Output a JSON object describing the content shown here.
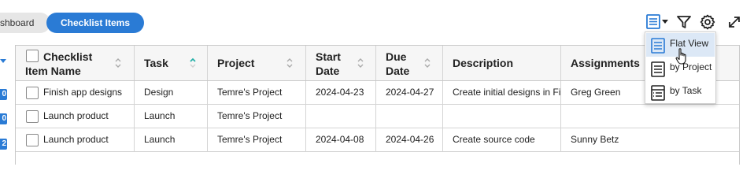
{
  "tabs": {
    "dashboard": "shboard",
    "active": "Checklist Items"
  },
  "toolbar": {
    "view_icon": "list-view-icon",
    "filter_icon": "filter-icon",
    "settings_icon": "gear-icon",
    "expand_icon": "expand-icon"
  },
  "gutter": {
    "badges": [
      "0",
      "0",
      "2"
    ]
  },
  "grid": {
    "headers": [
      {
        "line1": "Checklist",
        "line2": "Item Name"
      },
      {
        "line1": "Task"
      },
      {
        "line1": "Project"
      },
      {
        "line1": "Start",
        "line2": "Date"
      },
      {
        "line1": "Due",
        "line2": "Date"
      },
      {
        "line1": "Description"
      },
      {
        "line1": "Assignments"
      }
    ],
    "rows": [
      {
        "name": "Finish app designs",
        "task": "Design",
        "project": "Temre's Project",
        "start": "2024-04-23",
        "due": "2024-04-27",
        "description": "Create initial designs in Figma",
        "assignments": "Greg Green"
      },
      {
        "name": "Launch product",
        "task": "Launch",
        "project": "Temre's Project",
        "start": "",
        "due": "",
        "description": "",
        "assignments": ""
      },
      {
        "name": "Launch product",
        "task": "Launch",
        "project": "Temre's Project",
        "start": "2024-04-08",
        "due": "2024-04-26",
        "description": "Create source code",
        "assignments": "Sunny Betz"
      }
    ]
  },
  "view_menu": {
    "items": [
      {
        "label": "Flat View",
        "icon": "flat-view-icon",
        "selected": true
      },
      {
        "label": "by Project",
        "icon": "by-project-icon",
        "selected": false
      },
      {
        "label": "by Task",
        "icon": "by-task-icon",
        "selected": false
      }
    ]
  },
  "colors": {
    "accent": "#2a7bd5",
    "sort_active": "#26b0a8",
    "selected_bg": "#dce8f6"
  }
}
